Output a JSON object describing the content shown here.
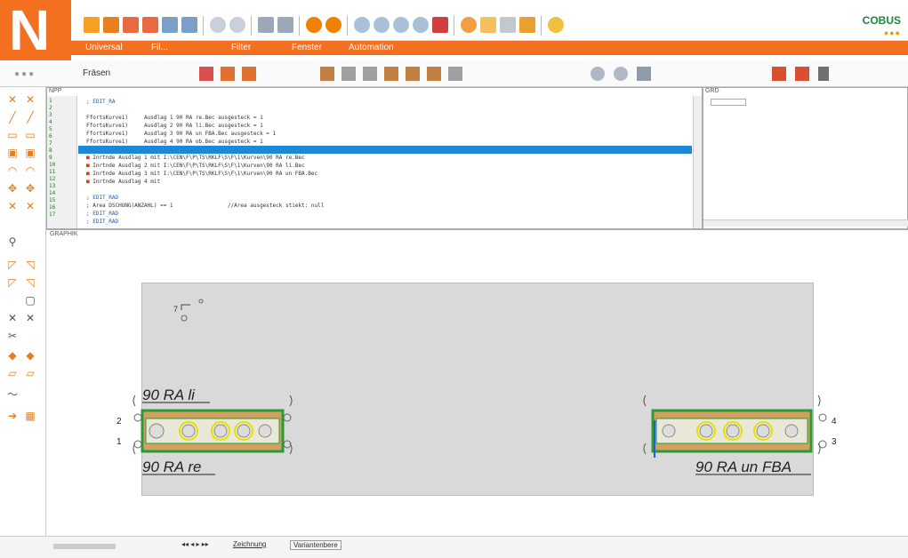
{
  "app": {
    "logo_letter": "N",
    "brand": "COBUS",
    "brand_dots": "●●●"
  },
  "menu": {
    "items": [
      "Universal",
      "Fil...",
      "Filter",
      "Fenster",
      "Automation"
    ]
  },
  "toolbar2": {
    "folder_label": "Fräsen"
  },
  "code_panel": {
    "caption": "NPP",
    "gutter": [
      "1",
      "2",
      "3",
      "4",
      "5",
      "6",
      "7",
      "8",
      "9",
      "10",
      "11",
      "12",
      "13",
      "14",
      "15",
      "16",
      "17"
    ],
    "lines": [
      {
        "text": "; EDIT_RA",
        "style": "blue"
      },
      {
        "text": "",
        "style": ""
      },
      {
        "text": "FfortsKurve1)     Ausdlag 1 90 RA re.Bec ausgesteck = 1",
        "style": ""
      },
      {
        "text": "FfortsKurve1)     Ausdlag 2 90 RA li.Bec ausgesteck = 1",
        "style": ""
      },
      {
        "text": "FfortsKurve1)     Ausdlag 3 90 RA un FBA.Bec ausgesteck = 1",
        "style": ""
      },
      {
        "text": "FfortsKurve1)     Ausdlag 4 90 RA ob.Bec ausgesteck = 1",
        "style": ""
      },
      {
        "text": "",
        "style": "highlight"
      },
      {
        "text": "Inrtnde Ausdlag 1 mit I:\\CEN\\F\\P\\TS\\RKLF\\S\\F\\1\\Kurven\\90 RA re.Bec",
        "style": "mark"
      },
      {
        "text": "Inrtnde Ausdlag 2 mit I:\\CEN\\F\\P\\TS\\RKLF\\S\\F\\1\\Kurven\\90 RA li.Bec",
        "style": "mark"
      },
      {
        "text": "Inrtnde Ausdlag 3 mit I:\\CEN\\F\\P\\TS\\RKLF\\S\\F\\1\\Kurven\\90 RA un FBA.Bec",
        "style": "mark"
      },
      {
        "text": "Inrtnde Ausdlag 4 mit",
        "style": "mark"
      },
      {
        "text": "",
        "style": ""
      },
      {
        "text": "; EDIT_RAD",
        "style": "blue"
      },
      {
        "text": "; Area DSCHUNG(ANZAHL) == 1                 //Area ausgesteck stiekt: null",
        "style": ""
      },
      {
        "text": "; EDIT_RAD",
        "style": "blue"
      },
      {
        "text": "; EDIT_RAD",
        "style": "blue"
      }
    ]
  },
  "right_panel": {
    "caption": "GRD"
  },
  "drawing": {
    "caption": "GRAPHIK",
    "labels": {
      "left_top": "90 RA li",
      "left_bottom": "90 RA re",
      "right_bottom": "90 RA un FBA",
      "num_1": "1",
      "num_2": "2",
      "num_3": "3",
      "num_4": "4",
      "small_marker": "7"
    }
  },
  "bottom": {
    "tabs": [
      "Zeichnung",
      "Variantenbere"
    ]
  },
  "colors": {
    "accent": "#f37021",
    "highlight": "#1e88d8",
    "rail_green": "#2a9a3a",
    "rail_fill": "#d4a060",
    "drill_yellow": "#e8e000"
  }
}
